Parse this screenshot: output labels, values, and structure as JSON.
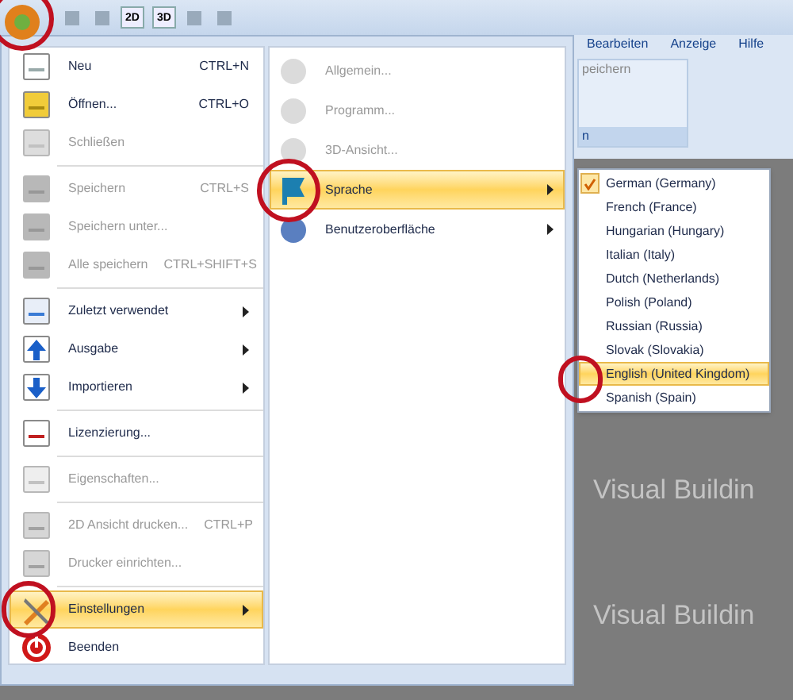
{
  "toolbar": {
    "buttons": [
      {
        "kind": "icon"
      },
      {
        "kind": "icon"
      },
      {
        "kind": "text",
        "label": "2D"
      },
      {
        "kind": "text",
        "label": "3D"
      },
      {
        "kind": "icon"
      },
      {
        "kind": "icon"
      }
    ]
  },
  "ribbon": {
    "tabs": [
      {
        "label": "Bearbeiten"
      },
      {
        "label": "Anzeige"
      },
      {
        "label": "Hilfe"
      }
    ],
    "group_label": "peichern",
    "group_footer": "n"
  },
  "menu": {
    "items": [
      {
        "kind": "command",
        "label": "Neu",
        "shortcut": "CTRL+N",
        "disabled": false,
        "selected": false
      },
      {
        "kind": "command",
        "label": "Öffnen...",
        "shortcut": "CTRL+O",
        "disabled": false,
        "selected": false
      },
      {
        "kind": "command",
        "label": "Schließen",
        "disabled": true,
        "selected": false
      },
      {
        "kind": "separator"
      },
      {
        "kind": "command",
        "label": "Speichern",
        "shortcut": "CTRL+S",
        "disabled": true,
        "selected": false
      },
      {
        "kind": "command",
        "label": "Speichern unter...",
        "disabled": true,
        "selected": false
      },
      {
        "kind": "command",
        "label": "Alle speichern",
        "shortcut": "CTRL+SHIFT+S",
        "disabled": true,
        "selected": false
      },
      {
        "kind": "separator"
      },
      {
        "kind": "submenu",
        "label": "Zuletzt verwendet",
        "disabled": false,
        "selected": false
      },
      {
        "kind": "submenu",
        "label": "Ausgabe",
        "disabled": false,
        "selected": false
      },
      {
        "kind": "submenu",
        "label": "Importieren",
        "disabled": false,
        "selected": false
      },
      {
        "kind": "separator"
      },
      {
        "kind": "command",
        "label": "Lizenzierung...",
        "disabled": false,
        "selected": false
      },
      {
        "kind": "separator"
      },
      {
        "kind": "command",
        "label": "Eigenschaften...",
        "disabled": true,
        "selected": false
      },
      {
        "kind": "separator"
      },
      {
        "kind": "command",
        "label": "2D Ansicht drucken...",
        "shortcut": "CTRL+P",
        "disabled": true,
        "selected": false
      },
      {
        "kind": "command",
        "label": "Drucker einrichten...",
        "disabled": true,
        "selected": false
      },
      {
        "kind": "separator"
      },
      {
        "kind": "submenu",
        "label": "Einstellungen",
        "disabled": false,
        "selected": true
      },
      {
        "kind": "command",
        "label": "Beenden",
        "disabled": false,
        "selected": false
      }
    ]
  },
  "settings_menu": {
    "items": [
      {
        "kind": "command",
        "label": "Allgemein...",
        "disabled": true,
        "selected": false
      },
      {
        "kind": "command",
        "label": "Programm...",
        "disabled": true,
        "selected": false
      },
      {
        "kind": "command",
        "label": "3D-Ansicht...",
        "disabled": true,
        "selected": false
      },
      {
        "kind": "submenu",
        "label": "Sprache",
        "disabled": false,
        "selected": true
      },
      {
        "kind": "submenu",
        "label": "Benutzeroberfläche",
        "disabled": false,
        "selected": false
      }
    ]
  },
  "language_menu": {
    "items": [
      {
        "label": "German (Germany)",
        "checked": true,
        "selected": false
      },
      {
        "label": "French (France)",
        "checked": false,
        "selected": false
      },
      {
        "label": "Hungarian (Hungary)",
        "checked": false,
        "selected": false
      },
      {
        "label": "Italian (Italy)",
        "checked": false,
        "selected": false
      },
      {
        "label": "Dutch (Netherlands)",
        "checked": false,
        "selected": false
      },
      {
        "label": "Polish (Poland)",
        "checked": false,
        "selected": false
      },
      {
        "label": "Russian (Russia)",
        "checked": false,
        "selected": false
      },
      {
        "label": "Slovak (Slovakia)",
        "checked": false,
        "selected": false
      },
      {
        "label": "English (United Kingdom)",
        "checked": false,
        "selected": true
      },
      {
        "label": "Spanish (Spain)",
        "checked": false,
        "selected": false
      }
    ]
  },
  "background_logos": [
    "Visual Buildin",
    "Visual Buildin"
  ]
}
